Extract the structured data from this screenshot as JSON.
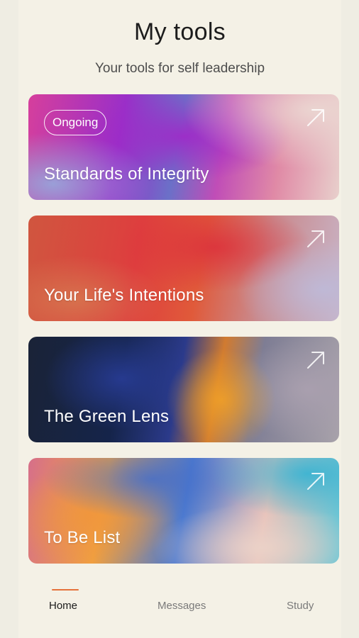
{
  "header": {
    "title": "My tools",
    "subtitle": "Your tools for self leadership"
  },
  "tools": [
    {
      "name": "Standards of Integrity",
      "badge": "Ongoing",
      "icon": "arrow-up-right-icon"
    },
    {
      "name": "Your Life's Intentions",
      "icon": "arrow-up-right-icon"
    },
    {
      "name": "The Green Lens",
      "icon": "arrow-up-right-icon"
    },
    {
      "name": "To Be List",
      "icon": "arrow-up-right-icon"
    }
  ],
  "tabbar": {
    "items": [
      {
        "label": "Home",
        "active": true
      },
      {
        "label": "Messages",
        "active": false
      },
      {
        "label": "Study",
        "active": false
      }
    ],
    "indicator_color": "#e5723b"
  },
  "colors": {
    "background": "#f4f1e6",
    "text": "#1c1c1c"
  }
}
